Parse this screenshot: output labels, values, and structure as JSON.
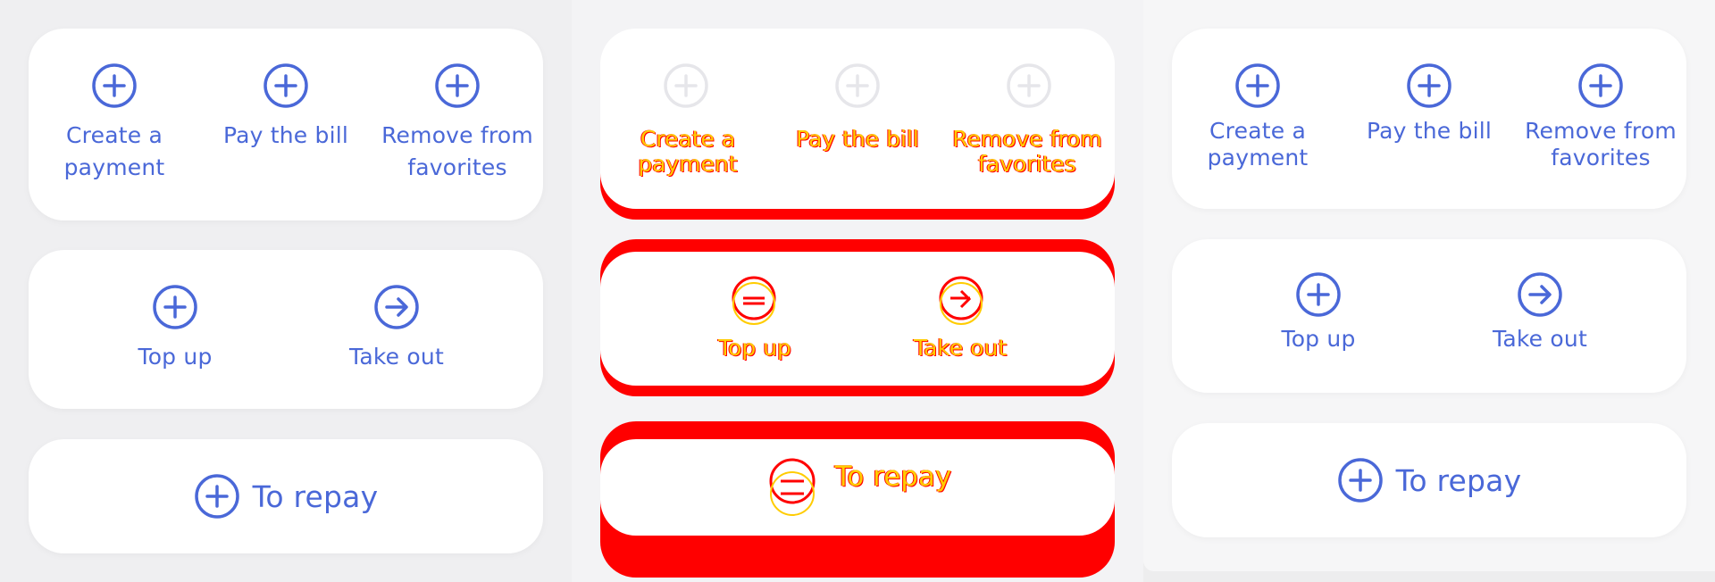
{
  "colors": {
    "accent": "#4a68d8",
    "card": "#ffffff",
    "background": "#efeff1",
    "artifact_red": "#ff0000",
    "artifact_yellow": "#ffcc00"
  },
  "variants": {
    "left": {
      "actions": [
        {
          "label": "Create a payment",
          "icon": "plus-circle-icon"
        },
        {
          "label": "Pay the bill",
          "icon": "plus-circle-icon"
        },
        {
          "label": "Remove from favorites",
          "icon": "plus-circle-icon"
        }
      ],
      "transfers": [
        {
          "label": "Top up",
          "icon": "plus-circle-icon"
        },
        {
          "label": "Take out",
          "icon": "arrow-right-circle-icon"
        }
      ],
      "repay": {
        "label": "To repay",
        "icon": "plus-circle-icon"
      }
    },
    "middle": {
      "actions": [
        {
          "label": "Create a payment"
        },
        {
          "label": "Pay the bill"
        },
        {
          "label": "Remove from favorites"
        }
      ],
      "transfers": [
        {
          "label": "Top up"
        },
        {
          "label": "Take out"
        }
      ],
      "repay": {
        "label": "To repay"
      }
    },
    "right": {
      "actions": [
        {
          "label": "Create a payment",
          "icon": "plus-circle-icon"
        },
        {
          "label": "Pay the bill",
          "icon": "plus-circle-icon"
        },
        {
          "label": "Remove from favorites",
          "icon": "plus-circle-icon"
        }
      ],
      "transfers": [
        {
          "label": "Top up",
          "icon": "plus-circle-icon"
        },
        {
          "label": "Take out",
          "icon": "arrow-right-circle-icon"
        }
      ],
      "repay": {
        "label": "To repay",
        "icon": "plus-circle-icon"
      }
    }
  }
}
